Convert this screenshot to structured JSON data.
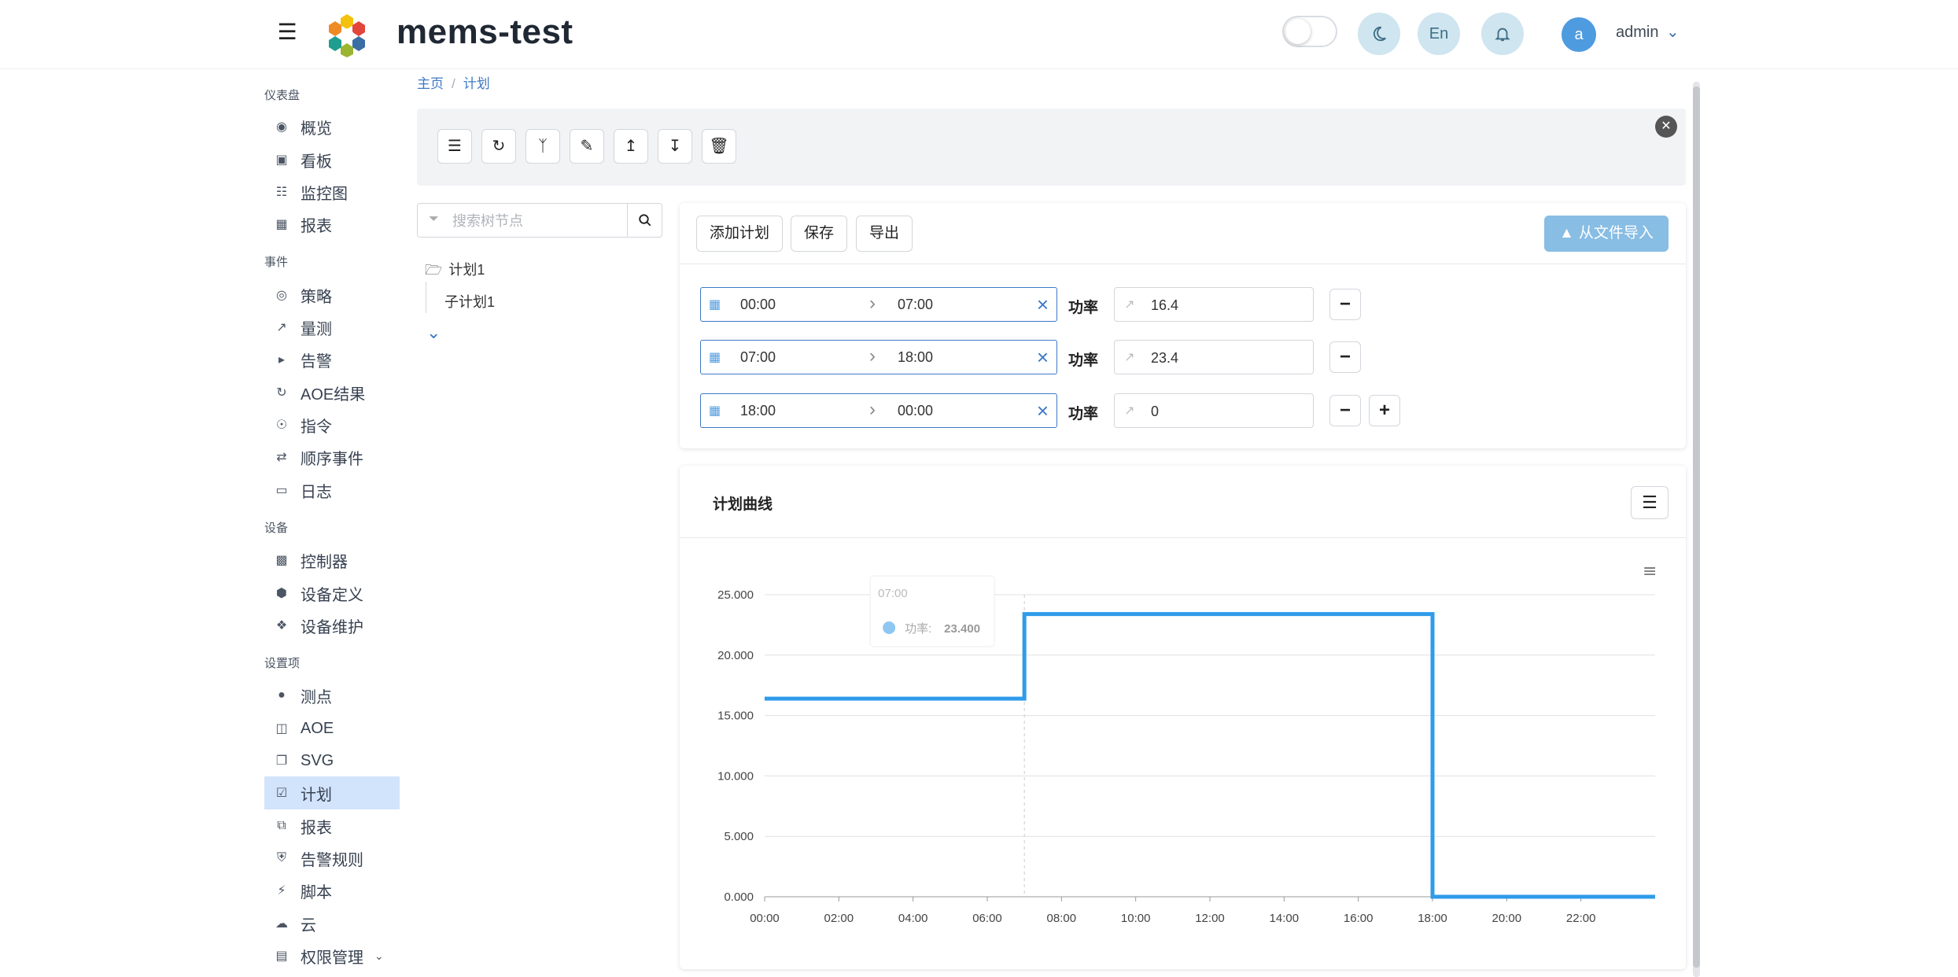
{
  "header": {
    "app_title": "mems-test",
    "lang_button": "En",
    "avatar_letter": "a",
    "username": "admin"
  },
  "sidebar": {
    "sections": [
      {
        "title": "仪表盘",
        "items": [
          {
            "label": "概览",
            "icon": "dashboard-icon"
          },
          {
            "label": "看板",
            "icon": "board-icon"
          },
          {
            "label": "监控图",
            "icon": "sitemap-icon"
          },
          {
            "label": "报表",
            "icon": "table-icon"
          }
        ]
      },
      {
        "title": "事件",
        "items": [
          {
            "label": "策略",
            "icon": "compass-icon"
          },
          {
            "label": "量测",
            "icon": "line-chart-icon"
          },
          {
            "label": "告警",
            "icon": "megaphone-icon"
          },
          {
            "label": "AOE结果",
            "icon": "refresh-icon"
          },
          {
            "label": "指令",
            "icon": "broadcast-icon"
          },
          {
            "label": "顺序事件",
            "icon": "shuffle-icon"
          },
          {
            "label": "日志",
            "icon": "book-icon"
          }
        ]
      },
      {
        "title": "设备",
        "items": [
          {
            "label": "控制器",
            "icon": "chip-icon"
          },
          {
            "label": "设备定义",
            "icon": "cube-icon"
          },
          {
            "label": "设备维护",
            "icon": "cubes-icon"
          }
        ]
      },
      {
        "title": "设置项",
        "items": [
          {
            "label": "测点",
            "icon": "pin-icon"
          },
          {
            "label": "AOE",
            "icon": "diagram-icon"
          },
          {
            "label": "SVG",
            "icon": "clone-icon"
          },
          {
            "label": "计划",
            "icon": "calendar-check-icon",
            "active": true
          },
          {
            "label": "报表",
            "icon": "copy-icon"
          },
          {
            "label": "告警规则",
            "icon": "shield-icon"
          },
          {
            "label": "脚本",
            "icon": "plug-icon"
          },
          {
            "label": "云",
            "icon": "cloud-icon"
          },
          {
            "label": "权限管理",
            "icon": "id-card-icon",
            "has_submenu": true
          }
        ]
      }
    ]
  },
  "breadcrumb": {
    "home": "主页",
    "sep": "/",
    "current": "计划"
  },
  "tree": {
    "search_placeholder": "搜索树节点",
    "root": "计划1",
    "child": "子计划1"
  },
  "plan": {
    "add_label": "添加计划",
    "save_label": "保存",
    "export_label": "导出",
    "import_label": "从文件导入",
    "power_label": "功率",
    "rows": [
      {
        "start": "00:00",
        "end": "07:00",
        "value": "16.4"
      },
      {
        "start": "07:00",
        "end": "18:00",
        "value": "23.4"
      },
      {
        "start": "18:00",
        "end": "00:00",
        "value": "0"
      }
    ]
  },
  "chart_card": {
    "title": "计划曲线"
  },
  "chart_data": {
    "type": "line",
    "step": true,
    "x": [
      "00:00",
      "07:00",
      "18:00",
      "24:00"
    ],
    "x_ticks": [
      "00:00",
      "02:00",
      "04:00",
      "06:00",
      "08:00",
      "10:00",
      "12:00",
      "14:00",
      "16:00",
      "18:00",
      "20:00",
      "22:00"
    ],
    "y_ticks": [
      "0.000",
      "5.000",
      "10.000",
      "15.000",
      "20.000",
      "25.000"
    ],
    "ylim": [
      0,
      25
    ],
    "xlim_hours": [
      0,
      24
    ],
    "series": [
      {
        "name": "功率",
        "points": [
          [
            0,
            16.4
          ],
          [
            7,
            16.4
          ],
          [
            7,
            23.4
          ],
          [
            18,
            23.4
          ],
          [
            18,
            0
          ],
          [
            24,
            0
          ]
        ],
        "color": "#2f9bea"
      }
    ],
    "tooltip": {
      "time": "07:00",
      "series": "功率",
      "value": "23.400"
    },
    "grid": true,
    "colors": {
      "line": "#2f9bea",
      "grid": "#e0e0e0"
    }
  }
}
